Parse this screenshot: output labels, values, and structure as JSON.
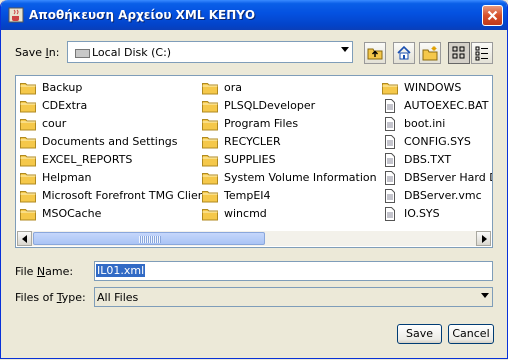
{
  "window": {
    "title": "Αποθήκευση Αρχείου XML ΚΕΠΥΟ"
  },
  "savein": {
    "label_pre": "Save ",
    "label_u": "I",
    "label_post": "n:",
    "value": "Local Disk (C:)"
  },
  "toolbar": {
    "icons": [
      "up-folder-icon",
      "home-icon",
      "new-folder-icon",
      "list-view-icon",
      "details-view-icon"
    ]
  },
  "files": {
    "col1": [
      {
        "name": "Backup",
        "type": "folder"
      },
      {
        "name": "CDExtra",
        "type": "folder"
      },
      {
        "name": "cour",
        "type": "folder"
      },
      {
        "name": "Documents and Settings",
        "type": "folder"
      },
      {
        "name": "EXCEL_REPORTS",
        "type": "folder"
      },
      {
        "name": "Helpman",
        "type": "folder"
      },
      {
        "name": "Microsoft Forefront TMG Client",
        "type": "folder"
      },
      {
        "name": "MSOCache",
        "type": "folder"
      }
    ],
    "col2": [
      {
        "name": "ora",
        "type": "folder"
      },
      {
        "name": "PLSQLDeveloper",
        "type": "folder"
      },
      {
        "name": "Program Files",
        "type": "folder"
      },
      {
        "name": "RECYCLER",
        "type": "folder"
      },
      {
        "name": "SUPPLIES",
        "type": "folder"
      },
      {
        "name": "System Volume Information",
        "type": "folder"
      },
      {
        "name": "TempEI4",
        "type": "folder"
      },
      {
        "name": "wincmd",
        "type": "folder"
      }
    ],
    "col3": [
      {
        "name": "WINDOWS",
        "type": "folder"
      },
      {
        "name": "AUTOEXEC.BAT",
        "type": "file"
      },
      {
        "name": "boot.ini",
        "type": "file"
      },
      {
        "name": "CONFIG.SYS",
        "type": "file"
      },
      {
        "name": "DBS.TXT",
        "type": "file"
      },
      {
        "name": "DBServer Hard Disk",
        "type": "file"
      },
      {
        "name": "DBServer.vmc",
        "type": "file"
      },
      {
        "name": "IO.SYS",
        "type": "file"
      }
    ]
  },
  "filename": {
    "label_pre": "File ",
    "label_u": "N",
    "label_post": "ame:",
    "value": "IL01.xml"
  },
  "filetype": {
    "label_pre": "Files of ",
    "label_u": "T",
    "label_post": "ype:",
    "value": "All Files"
  },
  "buttons": {
    "save": "Save",
    "cancel": "Cancel"
  },
  "colors": {
    "titlebar": "#0451e0",
    "selection": "#316ac5",
    "folder": "#f5c84a"
  }
}
